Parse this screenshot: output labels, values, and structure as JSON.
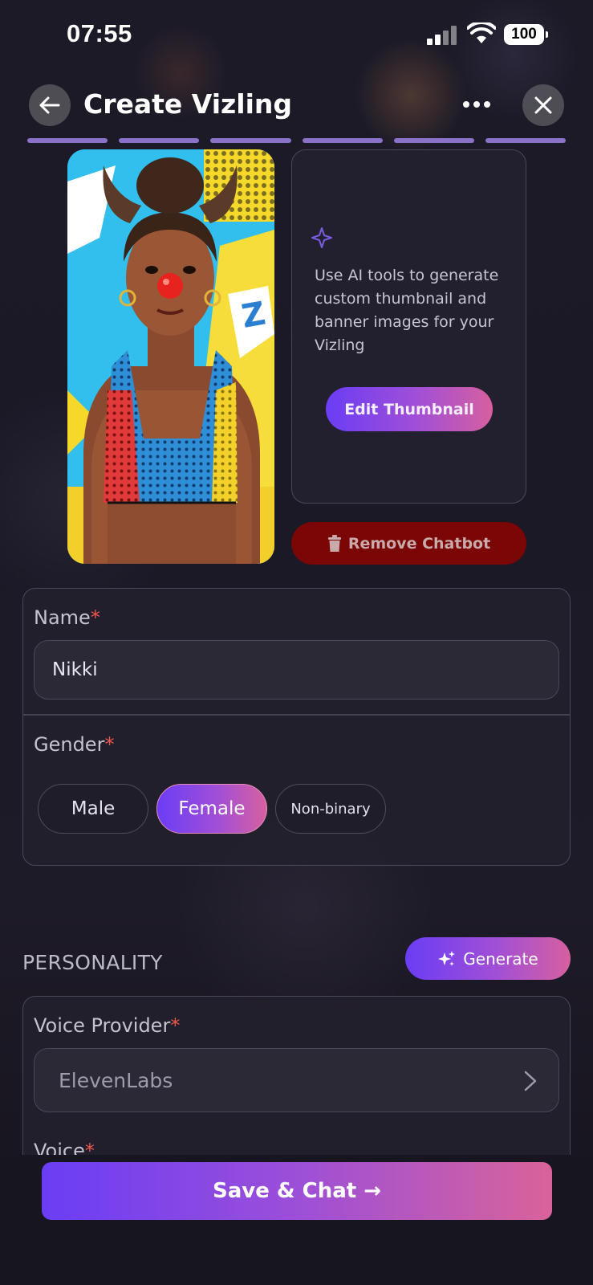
{
  "status_bar": {
    "time": "07:55",
    "battery": "100"
  },
  "header": {
    "title": "Create Vizling"
  },
  "progress": {
    "steps_total": 6,
    "steps_completed": 6
  },
  "thumbnail": {
    "description_text": "Use AI tools to generate custom thumbnail and banner images for your Vizling",
    "edit_button_label": "Edit Thumbnail",
    "remove_button_label": "Remove Chatbot"
  },
  "form": {
    "name": {
      "label": "Name",
      "required_mark": "*",
      "value": "Nikki"
    },
    "gender": {
      "label": "Gender",
      "required_mark": "*",
      "options": [
        "Male",
        "Female",
        "Non-binary"
      ],
      "selected": "Female"
    }
  },
  "personality": {
    "heading": "PERSONALITY",
    "generate_button_label": "Generate",
    "voice_provider": {
      "label": "Voice Provider",
      "required_mark": "*",
      "value": "ElevenLabs"
    },
    "voice": {
      "label": "Voice",
      "required_mark": "*"
    }
  },
  "footer": {
    "save_button_label": "Save & Chat →"
  },
  "colors": {
    "accent_start": "#6a3df5",
    "accent_end": "#d6609f",
    "danger": "#7a0606",
    "required": "#f0564d",
    "step_bar": "#8b72c9"
  }
}
